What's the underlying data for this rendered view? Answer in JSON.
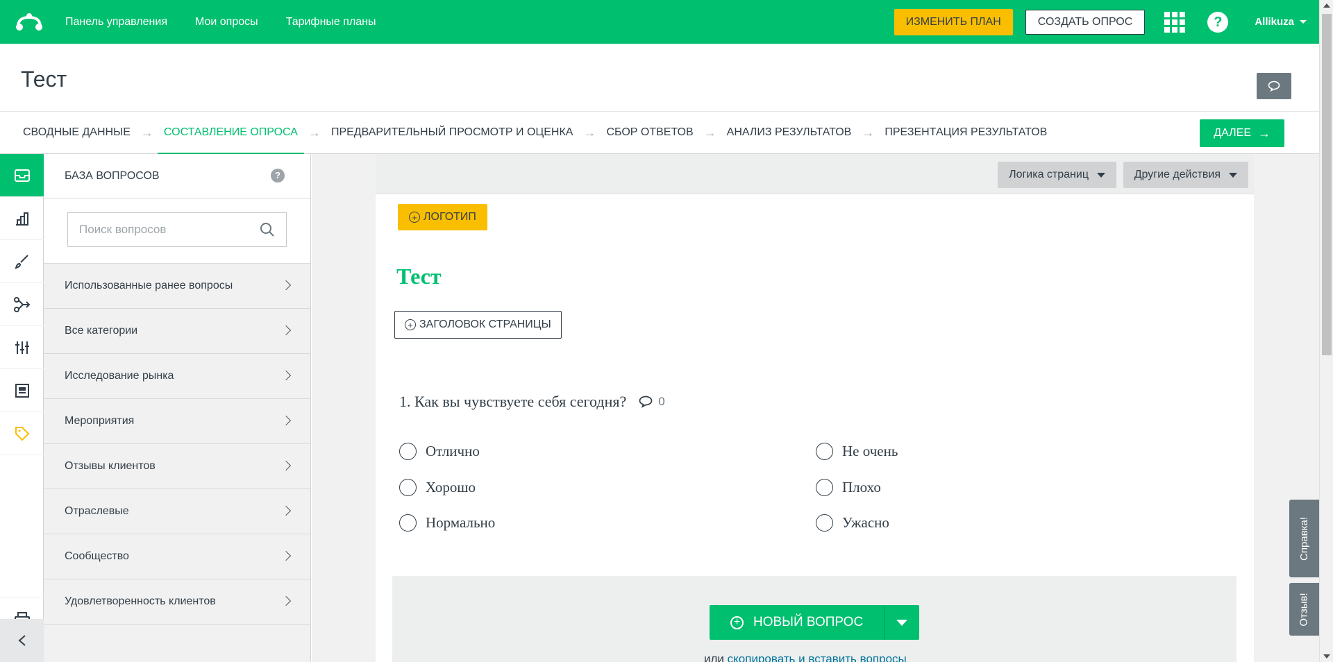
{
  "topnav": {
    "links": [
      "Панель управления",
      "Мои опросы",
      "Тарифные планы"
    ],
    "upgrade_label": "ИЗМЕНИТЬ ПЛАН",
    "create_label": "СОЗДАТЬ ОПРОС",
    "help_glyph": "?",
    "username": "Allikuza",
    "brand_color": "#00bf6f"
  },
  "survey": {
    "title": "Тест"
  },
  "steps": {
    "items": [
      "СВОДНЫЕ ДАННЫЕ",
      "СОСТАВЛЕНИЕ ОПРОСА",
      "ПРЕДВАРИТЕЛЬНЫЙ ПРОСМОТР И ОЦЕНКА",
      "СБОР ОТВЕТОВ",
      "АНАЛИЗ РЕЗУЛЬТАТОВ",
      "ПРЕЗЕНТАЦИЯ РЕЗУЛЬТАТОВ"
    ],
    "active_index": 1,
    "next_label": "ДАЛЕЕ"
  },
  "rail": {
    "icons": [
      "question-bank-icon",
      "themes-chart-icon",
      "design-brush-icon",
      "logic-icon",
      "options-sliders-icon",
      "layout-icon",
      "tag-icon",
      "print-icon",
      "collapse-chevron-icon"
    ]
  },
  "qbank": {
    "heading": "БАЗА ВОПРОСОВ",
    "help_glyph": "?",
    "search_placeholder": "Поиск вопросов",
    "categories": [
      "Использованные ранее вопросы",
      "Все категории",
      "Исследование рынка",
      "Мероприятия",
      "Отзывы клиентов",
      "Отраслевые",
      "Сообщество",
      "Удовлетворенность клиентов"
    ]
  },
  "canvas": {
    "page_logic_label": "Логика страниц",
    "more_actions_label": "Другие действия",
    "logo_label": "ЛОГОТИП",
    "title": "Тест",
    "page_title_label": "ЗАГОЛОВОК СТРАНИЦЫ",
    "question": {
      "text": "1. Как вы чувствуете себя сегодня?",
      "comment_count": "0",
      "options": [
        "Отлично",
        "Хорошо",
        "Нормально",
        "Не очень",
        "Плохо",
        "Ужасно"
      ]
    },
    "new_question_label": "НОВЫЙ ВОПРОС",
    "copy_prefix": "или",
    "copy_link": "скопировать и вставить вопросы"
  },
  "side_tabs": {
    "help": "Справка!",
    "feedback": "Отзыв!"
  },
  "colors": {
    "brand": "#00bf6f",
    "accent_yellow": "#f9be00",
    "text": "#333e48"
  }
}
